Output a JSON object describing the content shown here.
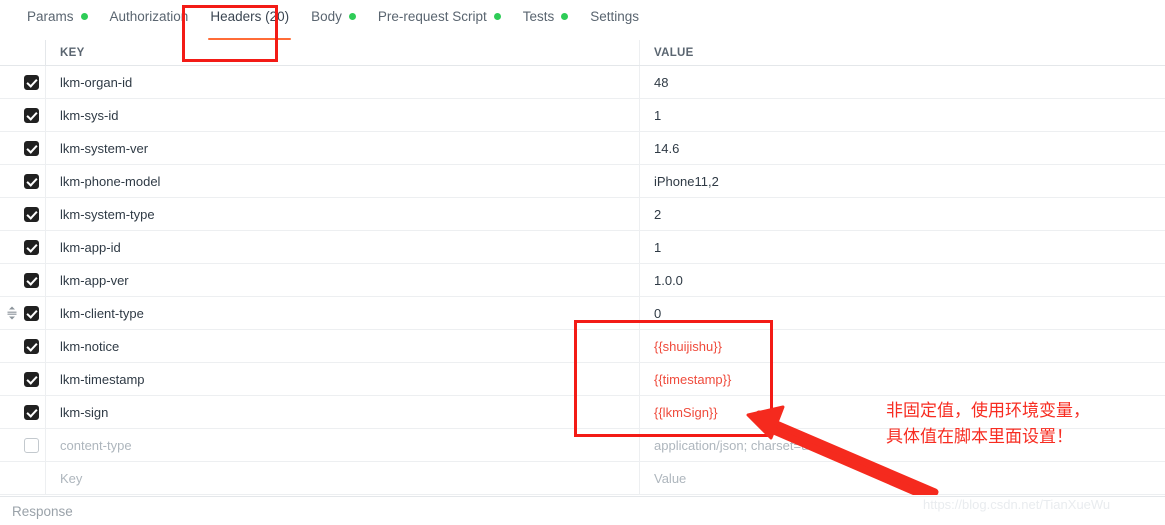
{
  "tabs": [
    {
      "label": "Params",
      "dot": true,
      "active": false
    },
    {
      "label": "Authorization",
      "dot": false,
      "active": false
    },
    {
      "label": "Headers (20)",
      "dot": false,
      "active": true
    },
    {
      "label": "Body",
      "dot": true,
      "active": false
    },
    {
      "label": "Pre-request Script",
      "dot": true,
      "active": false
    },
    {
      "label": "Tests",
      "dot": true,
      "active": false
    },
    {
      "label": "Settings",
      "dot": false,
      "active": false
    }
  ],
  "table": {
    "columns": {
      "key": "KEY",
      "value": "VALUE"
    },
    "rows": [
      {
        "checked": true,
        "key": "lkm-organ-id",
        "value": "48",
        "key_muted": false,
        "value_muted": false,
        "value_variable": false,
        "drag": false
      },
      {
        "checked": true,
        "key": "lkm-sys-id",
        "value": "1",
        "key_muted": false,
        "value_muted": false,
        "value_variable": false,
        "drag": false
      },
      {
        "checked": true,
        "key": "lkm-system-ver",
        "value": "14.6",
        "key_muted": false,
        "value_muted": false,
        "value_variable": false,
        "drag": false
      },
      {
        "checked": true,
        "key": "lkm-phone-model",
        "value": "iPhone11,2",
        "key_muted": false,
        "value_muted": false,
        "value_variable": false,
        "drag": false
      },
      {
        "checked": true,
        "key": "lkm-system-type",
        "value": "2",
        "key_muted": false,
        "value_muted": false,
        "value_variable": false,
        "drag": false
      },
      {
        "checked": true,
        "key": "lkm-app-id",
        "value": "1",
        "key_muted": false,
        "value_muted": false,
        "value_variable": false,
        "drag": false
      },
      {
        "checked": true,
        "key": "lkm-app-ver",
        "value": "1.0.0",
        "key_muted": false,
        "value_muted": false,
        "value_variable": false,
        "drag": false
      },
      {
        "checked": true,
        "key": "lkm-client-type",
        "value": "0",
        "key_muted": false,
        "value_muted": false,
        "value_variable": false,
        "drag": true
      },
      {
        "checked": true,
        "key": "lkm-notice",
        "value": "{{shuijishu}}",
        "key_muted": false,
        "value_muted": false,
        "value_variable": true,
        "drag": false
      },
      {
        "checked": true,
        "key": "lkm-timestamp",
        "value": "{{timestamp}}",
        "key_muted": false,
        "value_muted": false,
        "value_variable": true,
        "drag": false
      },
      {
        "checked": true,
        "key": "lkm-sign",
        "value": "{{lkmSign}}",
        "key_muted": false,
        "value_muted": false,
        "value_variable": true,
        "drag": false
      },
      {
        "checked": false,
        "key": "content-type",
        "value": "application/json; charset=utf-8",
        "key_muted": true,
        "value_muted": true,
        "value_variable": false,
        "drag": false
      },
      {
        "checked": null,
        "key": "Key",
        "value": "Value",
        "key_muted": true,
        "value_muted": true,
        "value_variable": false,
        "drag": false
      }
    ]
  },
  "response": {
    "label": "Response"
  },
  "annotations": {
    "note_text": "非固定值，使用环境变量，\n具体值在脚本里面设置！",
    "note_color": "#f72c21",
    "box_color": "#f31b16",
    "highlighted_tab": "Headers (20)",
    "highlighted_values": [
      "{{shuijishu}}",
      "{{timestamp}}",
      "{{lkmSign}}"
    ]
  },
  "watermark": {
    "text": "https://blog.csdn.net/TianXueWu"
  },
  "colors": {
    "accent": "#ff6c37",
    "status_dot": "#2ecc57",
    "variable": "#ef4b3c",
    "annotation": "#f31b16"
  }
}
